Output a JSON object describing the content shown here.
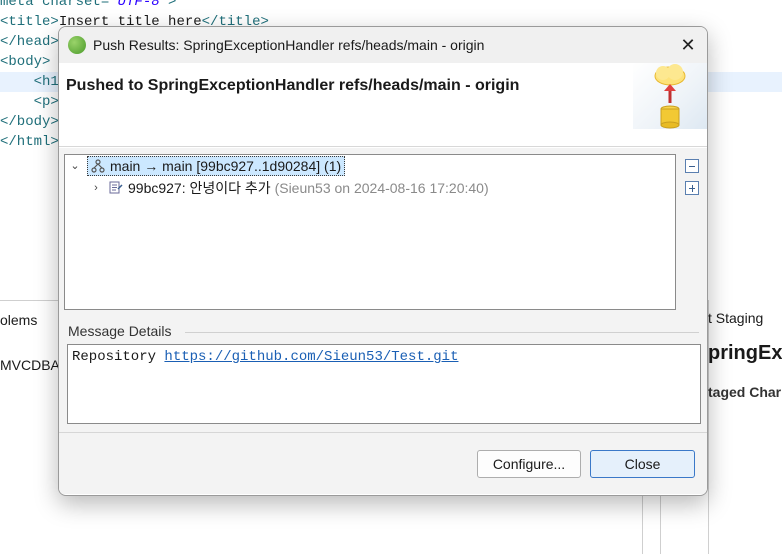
{
  "editor": {
    "lines": [
      {
        "a": "meta charset= ",
        "b": "UTF-8",
        "c": " >"
      },
      {
        "a": "title>",
        "b": "Insert title here",
        "c": "</title>"
      },
      {
        "a": "/head>"
      },
      {
        "a": "body>"
      },
      {
        "a": "    <h1"
      },
      {
        "a": "    <p>"
      },
      {
        "a": "/body>"
      },
      {
        "a": "/html>"
      }
    ]
  },
  "background": {
    "left_tab": "olems",
    "left_item": "MVCDBA",
    "right_tab": "t Staging",
    "right_title": "pringExc",
    "right_sub": "taged Char"
  },
  "dialog": {
    "title": "Push Results: SpringExceptionHandler refs/heads/main - origin",
    "close_glyph": "✕",
    "header_title": "Pushed to SpringExceptionHandler refs/heads/main - origin",
    "tree": {
      "branch_row": "main → main [99bc927..1d90284] (1)",
      "commit_row_main": "99bc927: 안녕이다 추가",
      "commit_row_meta": "(Sieun53 on 2024-08-16 17:20:40)",
      "expanded_chevron": "⌄",
      "collapsed_chevron": "›"
    },
    "message_details": {
      "label": "Message Details",
      "prefix": "Repository ",
      "link": "https://github.com/Sieun53/Test.git"
    },
    "buttons": {
      "configure": "Configure...",
      "close": "Close"
    }
  },
  "icons": {
    "app": "spring-icon",
    "branch": "branch-icon",
    "commit": "commit-icon",
    "collapse_all": "collapse-all-icon",
    "expand_all": "expand-all-icon",
    "push_wizard": "push-to-repository-icon"
  },
  "colors": {
    "accent": "#3a78c8",
    "link": "#1a5fb4",
    "selection": "#cce8ff"
  }
}
